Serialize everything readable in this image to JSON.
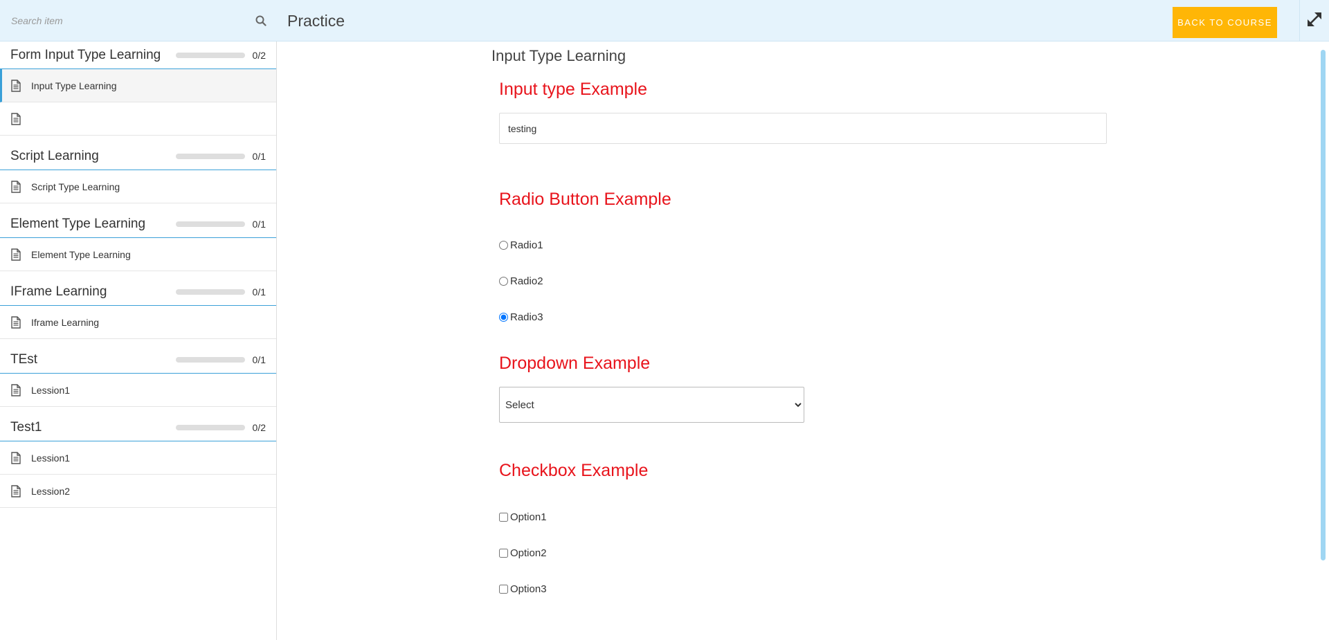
{
  "header": {
    "search_placeholder": "Search item",
    "title": "Practice",
    "back_label": "Back to course"
  },
  "sidebar": {
    "sections": [
      {
        "title": "Form Input Type Learning",
        "progress": "0/2",
        "progress_fraction": 0,
        "lessons": [
          {
            "label": "Input Type Learning",
            "active": true
          },
          {
            "label": "",
            "active": false
          }
        ]
      },
      {
        "title": "Script Learning",
        "progress": "0/1",
        "progress_fraction": 0,
        "lessons": [
          {
            "label": "Script Type Learning",
            "active": false
          }
        ]
      },
      {
        "title": "Element Type Learning",
        "progress": "0/1",
        "progress_fraction": 0,
        "lessons": [
          {
            "label": "Element Type Learning",
            "active": false
          }
        ]
      },
      {
        "title": "IFrame Learning",
        "progress": "0/1",
        "progress_fraction": 0,
        "lessons": [
          {
            "label": "Iframe Learning",
            "active": false
          }
        ]
      },
      {
        "title": "TEst",
        "progress": "0/1",
        "progress_fraction": 0,
        "lessons": [
          {
            "label": "Lession1",
            "active": false
          }
        ]
      },
      {
        "title": "Test1",
        "progress": "0/2",
        "progress_fraction": 0,
        "lessons": [
          {
            "label": "Lession1",
            "active": false
          },
          {
            "label": "Lession2",
            "active": false
          }
        ]
      }
    ]
  },
  "main": {
    "title": "Input Type Learning",
    "input_example": {
      "heading": "Input type Example",
      "value": "testing"
    },
    "radio_example": {
      "heading": "Radio Button Example",
      "options": [
        "Radio1",
        "Radio2",
        "Radio3"
      ],
      "selected": "Radio3"
    },
    "dropdown_example": {
      "heading": "Dropdown Example",
      "selected": "Select"
    },
    "checkbox_example": {
      "heading": "Checkbox Example",
      "options": [
        "Option1",
        "Option2",
        "Option3"
      ]
    }
  },
  "colors": {
    "accent": "#3aa0d8",
    "button": "#ffb606",
    "heading": "#e8141c",
    "header_bg": "#e5f3fc"
  }
}
